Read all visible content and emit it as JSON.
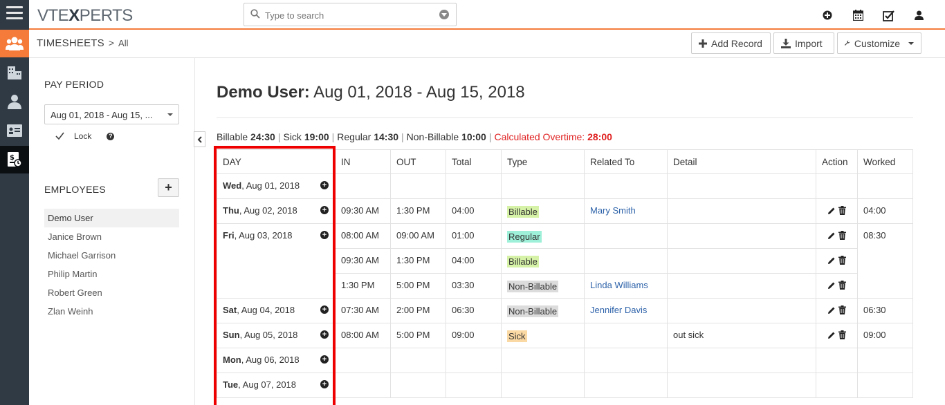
{
  "app": {
    "logo_prefix": "VTE",
    "logo_x": "X",
    "logo_suffix": "PERTS",
    "search_placeholder": "Type to search"
  },
  "breadcrumb": {
    "module": "TIMESHEETS",
    "separator": ">",
    "view": "All"
  },
  "toolbar": {
    "add_record": "Add Record",
    "import": "Import",
    "customize": "Customize"
  },
  "left_panel": {
    "pay_period_title": "PAY PERIOD",
    "pay_period_value": "Aug 01, 2018 - Aug 15, ...",
    "lock_label": "Lock",
    "help_glyph": "?",
    "employees_title": "EMPLOYEES",
    "add_button": "+",
    "employees": [
      "Demo User",
      "Janice Brown",
      "Michael Garrison",
      "Philip Martin",
      "Robert Green",
      "Zlan Weinh"
    ]
  },
  "main": {
    "heading_name": "Demo User:",
    "heading_range": "Aug 01, 2018 - Aug 15, 2018",
    "summary": {
      "billable_label": "Billable",
      "billable_value": "24:30",
      "sick_label": "Sick",
      "sick_value": "19:00",
      "regular_label": "Regular",
      "regular_value": "14:30",
      "nonbillable_label": "Non-Billable",
      "nonbillable_value": "10:00",
      "overtime_label": "Calculated Overtime:",
      "overtime_value": "28:00",
      "separator": "|"
    },
    "columns": [
      "DAY",
      "IN",
      "OUT",
      "Total",
      "Type",
      "Related To",
      "Detail",
      "Action",
      "Worked"
    ],
    "days": [
      {
        "weekday": "Wed",
        "date": ", Aug 01, 2018"
      },
      {
        "weekday": "Thu",
        "date": ", Aug 02, 2018"
      },
      {
        "weekday": "Fri",
        "date": ", Aug 03, 2018"
      },
      {
        "weekday": "Sat",
        "date": ", Aug 04, 2018"
      },
      {
        "weekday": "Sun",
        "date": ", Aug 05, 2018"
      },
      {
        "weekday": "Mon",
        "date": ", Aug 06, 2018"
      },
      {
        "weekday": "Tue",
        "date": ", Aug 07, 2018"
      }
    ],
    "entries": [
      {
        "in": "09:30 AM",
        "out": "1:30 PM",
        "total": "04:00",
        "type": "Billable",
        "related": "Mary Smith",
        "detail": "",
        "worked": "04:00"
      },
      {
        "in": "08:00 AM",
        "out": "09:00 AM",
        "total": "01:00",
        "type": "Regular",
        "related": "",
        "detail": "",
        "worked": "08:30"
      },
      {
        "in": "09:30 AM",
        "out": "1:30 PM",
        "total": "04:00",
        "type": "Billable",
        "related": "",
        "detail": "",
        "worked": ""
      },
      {
        "in": "1:30 PM",
        "out": "5:00 PM",
        "total": "03:30",
        "type": "Non-Billable",
        "related": "Linda Williams",
        "detail": "",
        "worked": ""
      },
      {
        "in": "07:30 AM",
        "out": "2:00 PM",
        "total": "06:30",
        "type": "Non-Billable",
        "related": "Jennifer Davis",
        "detail": "",
        "worked": "06:30"
      },
      {
        "in": "08:00 AM",
        "out": "5:00 PM",
        "total": "09:00",
        "type": "Sick",
        "related": "",
        "detail": "out sick",
        "worked": "09:00"
      }
    ]
  },
  "colors": {
    "accent": "#f47b3a",
    "rail": "#2f3a45",
    "overtime": "#e02020",
    "link": "#2d62a9",
    "highlight_box": "#ee0000"
  }
}
